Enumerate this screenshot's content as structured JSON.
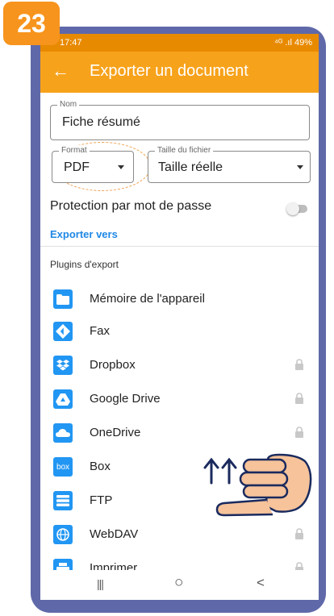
{
  "step_badge": "23",
  "status": {
    "time": "17:47",
    "signal_battery": "⁴ᴳ .ıl 49%"
  },
  "app_bar": {
    "title": "Exporter un document",
    "back_icon": "←"
  },
  "form": {
    "name_label": "Nom",
    "name_value": "Fiche résumé",
    "format_label": "Format",
    "format_value": "PDF",
    "size_label": "Taille du fichier",
    "size_value": "Taille réelle"
  },
  "protection": {
    "label": "Protection par mot de passe",
    "enabled": false
  },
  "export_to_label": "Exporter vers",
  "plugins": {
    "title": "Plugins d'export",
    "items": [
      {
        "label": "Mémoire de l'appareil",
        "icon": "folder-icon",
        "locked": false
      },
      {
        "label": "Fax",
        "icon": "fax-icon",
        "locked": false
      },
      {
        "label": "Dropbox",
        "icon": "dropbox-icon",
        "locked": true
      },
      {
        "label": "Google Drive",
        "icon": "google-drive-icon",
        "locked": true
      },
      {
        "label": "OneDrive",
        "icon": "onedrive-icon",
        "locked": true
      },
      {
        "label": "Box",
        "icon": "box-icon",
        "icon_text": "box",
        "locked": true
      },
      {
        "label": "FTP",
        "icon": "ftp-icon",
        "locked": true
      },
      {
        "label": "WebDAV",
        "icon": "webdav-icon",
        "locked": true
      },
      {
        "label": "Imprimer",
        "icon": "printer-icon",
        "locked": true
      }
    ]
  },
  "nav": {
    "recents": "|||",
    "home": "○",
    "back": "<"
  },
  "colors": {
    "accent": "#f7a21b",
    "status_bar": "#e88a00",
    "link": "#1e88e5",
    "icon_blue": "#2196f3",
    "frame": "#5f69a9"
  }
}
